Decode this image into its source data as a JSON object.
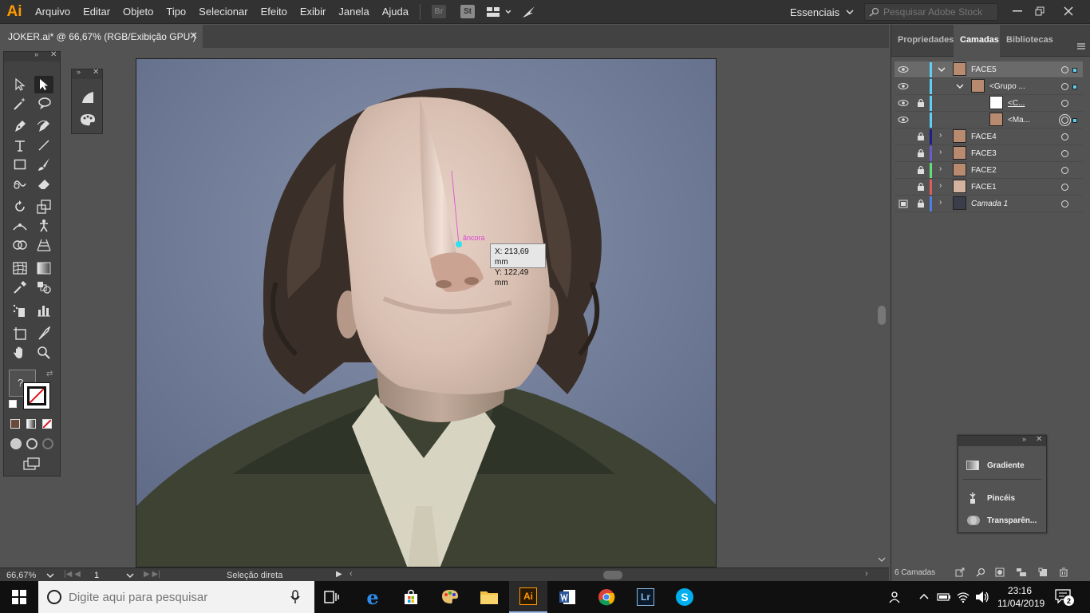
{
  "app": {
    "logo": "Ai",
    "name": "Adobe Illustrator"
  },
  "menu": [
    "Arquivo",
    "Editar",
    "Objeto",
    "Tipo",
    "Selecionar",
    "Efeito",
    "Exibir",
    "Janela",
    "Ajuda"
  ],
  "bridge_labels": {
    "br": "Br",
    "st": "St"
  },
  "workspace": "Essenciais",
  "stock_search_placeholder": "Pesquisar Adobe Stock",
  "document_tab": "JOKER.ai* @ 66,67% (RGB/Exibição GPU )",
  "canvas": {
    "coord_x": "X: 213,69 mm",
    "coord_y": "Y: 122,49 mm",
    "anchor_hint": "âncora"
  },
  "status": {
    "zoom": "66,67%",
    "artboard": "1",
    "tool_name": "Seleção direta"
  },
  "panel_tabs": [
    "Propriedades",
    "Camadas",
    "Bibliotecas"
  ],
  "layers": [
    {
      "name": "FACE5",
      "color": "#5fd0f5",
      "expanded": true,
      "eye": true,
      "lock": false,
      "selected": true
    },
    {
      "name": "<Grupo ...",
      "color": "#5fd0f5",
      "expanded": true,
      "eye": true,
      "lock": false
    },
    {
      "name": "<C...",
      "color": "#5fd0f5",
      "eye": true,
      "lock": true,
      "underline": true
    },
    {
      "name": "<Ma...",
      "color": "#5fd0f5",
      "eye": true,
      "lock": false
    },
    {
      "name": "FACE4",
      "color": "#1a1f8c",
      "eye": false,
      "lock": true
    },
    {
      "name": "FACE3",
      "color": "#6a5bd0",
      "eye": false,
      "lock": true
    },
    {
      "name": "FACE2",
      "color": "#5fe07a",
      "eye": false,
      "lock": true
    },
    {
      "name": "FACE1",
      "color": "#e35c5c",
      "eye": false,
      "lock": true
    },
    {
      "name": "Camada 1",
      "color": "#4f7fe0",
      "eye": false,
      "lock": true,
      "italic": true
    }
  ],
  "layers_count": "6 Camadas",
  "float_panel": [
    "Gradiente",
    "Pincéis",
    "Transparên..."
  ],
  "taskbar": {
    "search_placeholder": "Digite aqui para pesquisar",
    "time": "23:16",
    "date": "11/04/2019",
    "notifications": "2"
  },
  "colors": {
    "accent_ai": "#ff9a00",
    "selection_blue": "#46a3f2"
  }
}
